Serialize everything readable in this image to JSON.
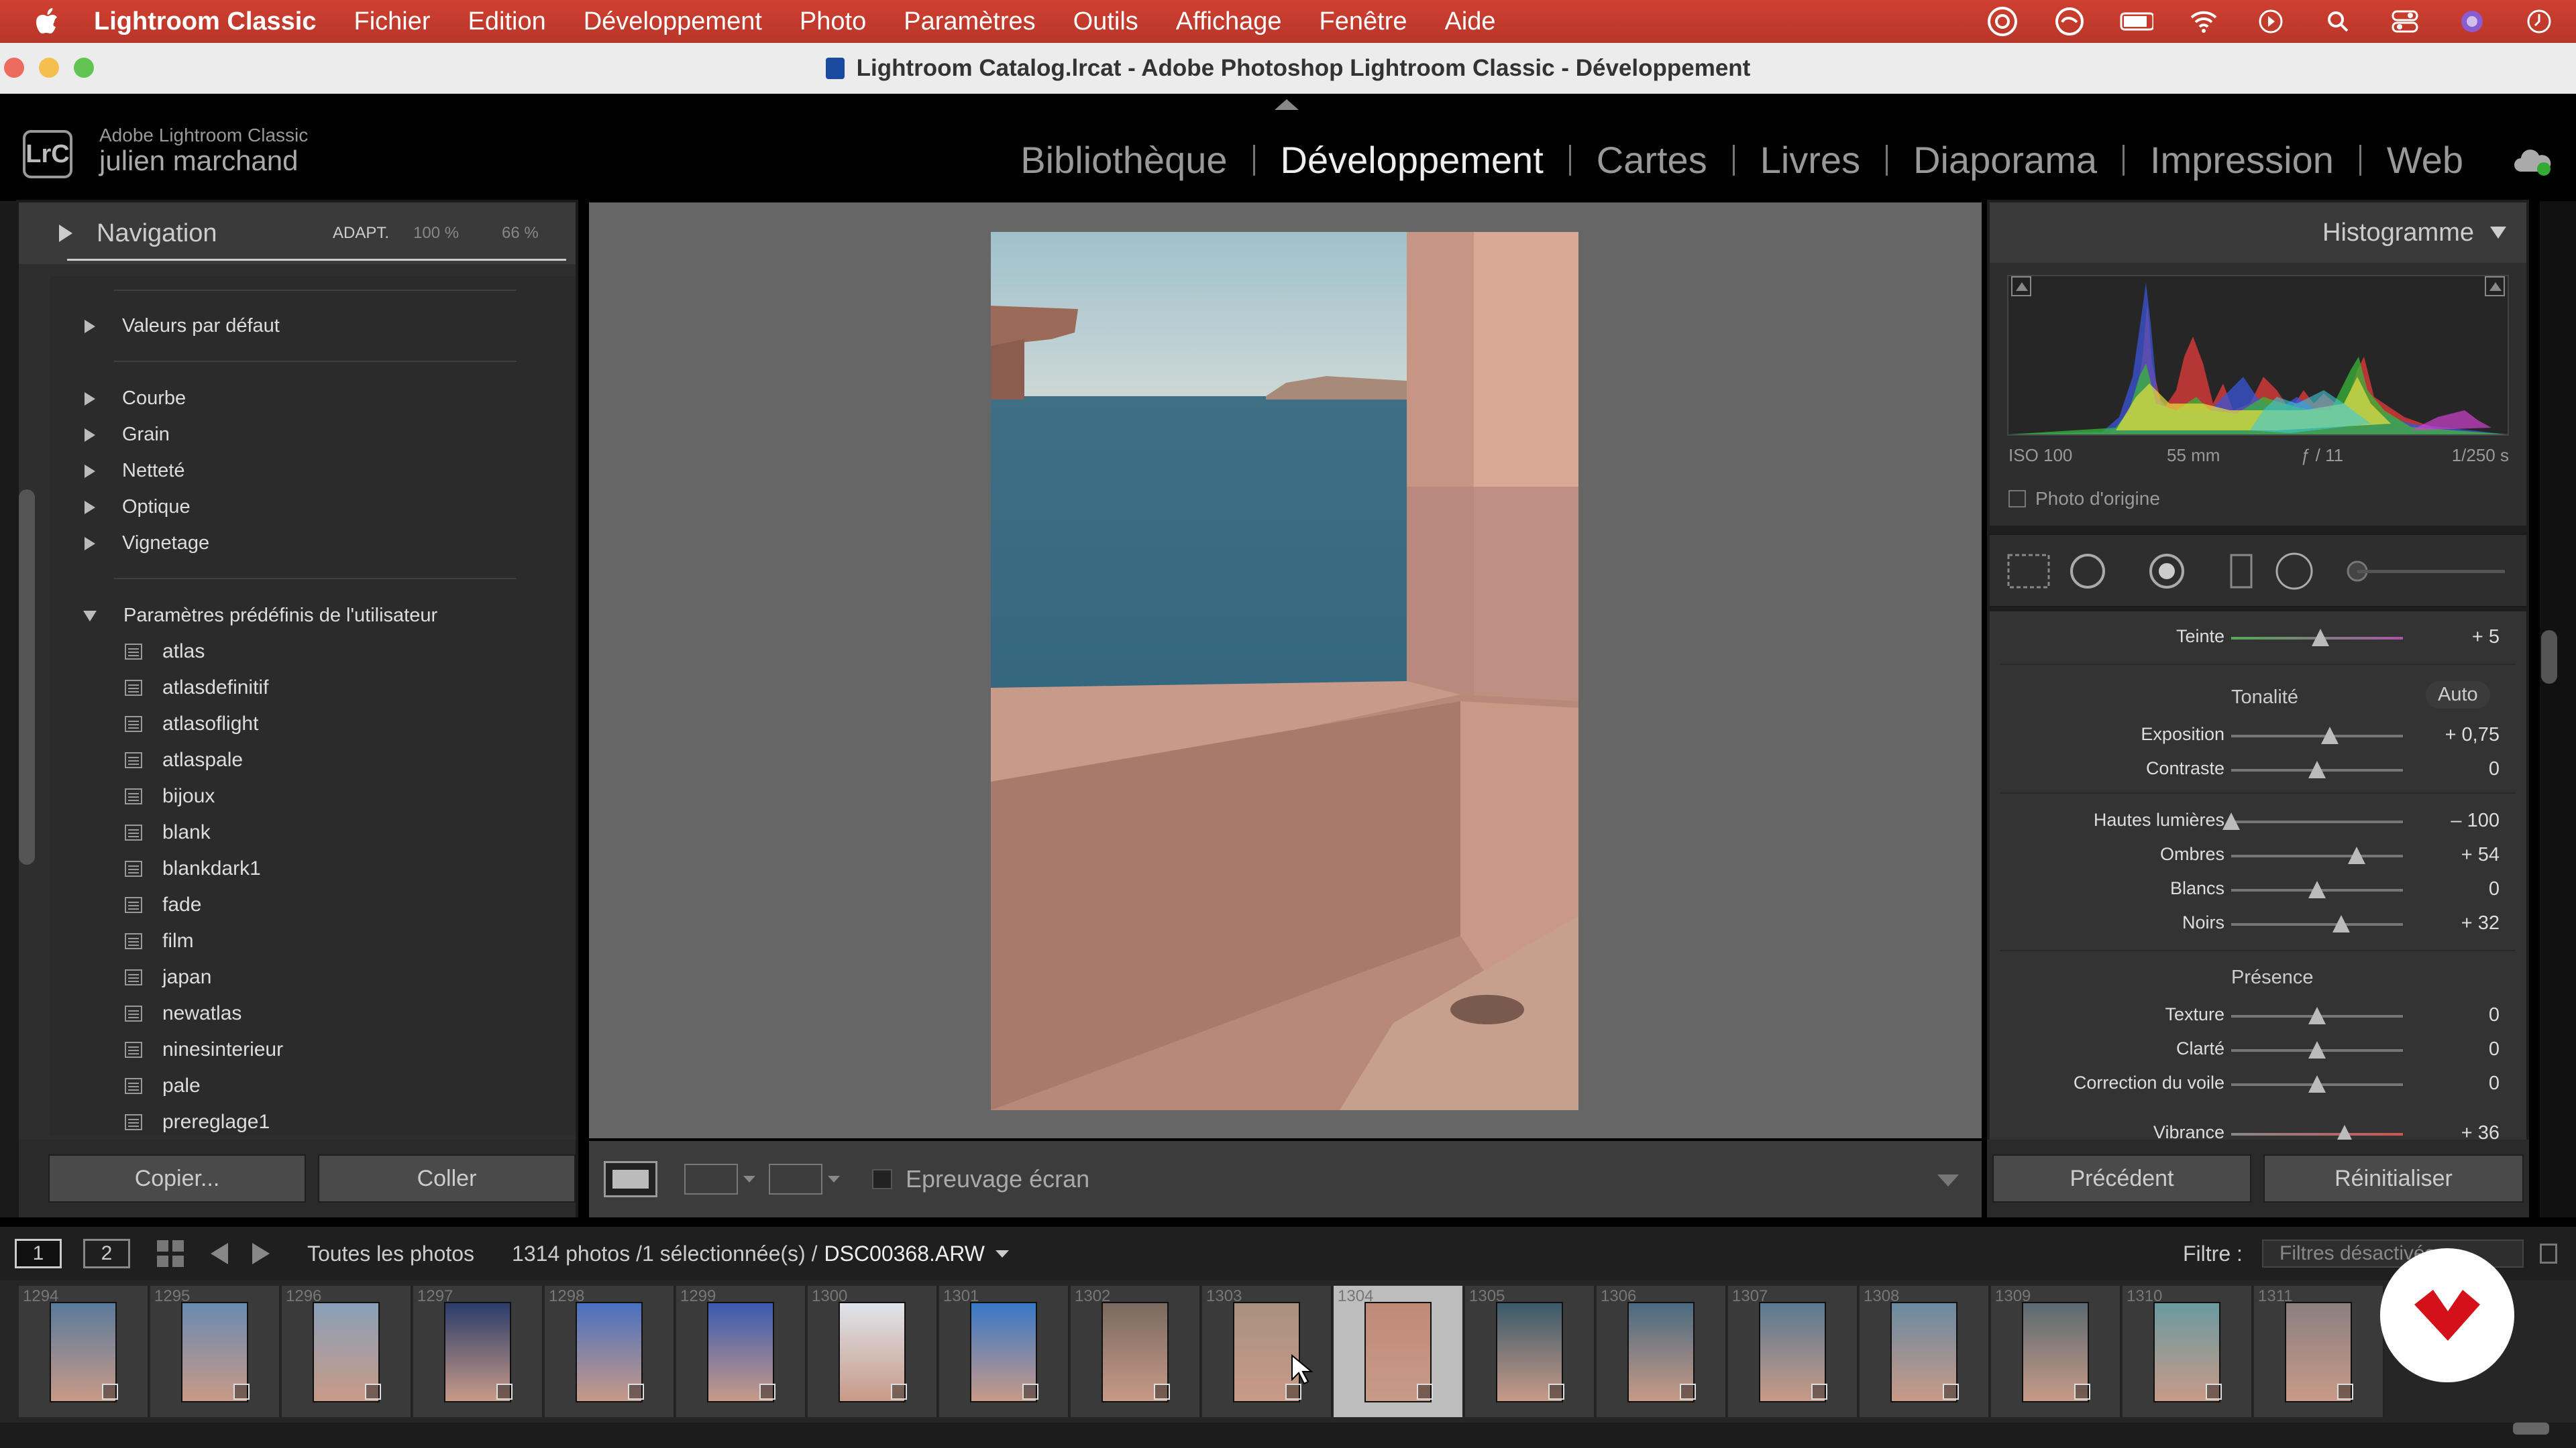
{
  "menubar": {
    "app": "Lightroom Classic",
    "items": [
      "Fichier",
      "Edition",
      "Développement",
      "Photo",
      "Paramètres",
      "Outils",
      "Affichage",
      "Fenêtre",
      "Aide"
    ]
  },
  "window": {
    "title": "Lightroom Catalog.lrcat - Adobe Photoshop Lightroom Classic - Développement"
  },
  "identity": {
    "logo": "LrC",
    "product": "Adobe Lightroom Classic",
    "user": "julien marchand"
  },
  "modules": [
    "Bibliothèque",
    "Développement",
    "Cartes",
    "Livres",
    "Diaporama",
    "Impression",
    "Web"
  ],
  "navigator": {
    "title": "Navigation",
    "fit": "ADAPT.",
    "zoom1": "100 %",
    "zoom2": "66 %"
  },
  "presets": {
    "groups": [
      "Valeurs par défaut",
      "Courbe",
      "Grain",
      "Netteté",
      "Optique",
      "Vignetage"
    ],
    "user_group": "Paramètres prédéfinis de l'utilisateur",
    "user_items": [
      "atlas",
      "atlasdefinitif",
      "atlasoflight",
      "atlaspale",
      "bijoux",
      "blank",
      "blankdark1",
      "fade",
      "film",
      "japan",
      "newatlas",
      "ninesinterieur",
      "pale",
      "prereglage1"
    ]
  },
  "left_buttons": {
    "copy": "Copier...",
    "paste": "Coller"
  },
  "toolbar": {
    "proof": "Epreuvage écran"
  },
  "histogram": {
    "title": "Histogramme",
    "iso": "ISO 100",
    "focal": "55 mm",
    "aperture": "ƒ / 11",
    "shutter": "1/250 s",
    "original": "Photo d'origine"
  },
  "basic": {
    "tint": {
      "label": "Teinte",
      "value": "+ 5",
      "level": 0.52
    },
    "tone_title": "Tonalité",
    "auto": "Auto",
    "tone": [
      {
        "label": "Exposition",
        "value": "+ 0,75",
        "level": 0.575
      },
      {
        "label": "Contraste",
        "value": "0",
        "level": 0.5
      }
    ],
    "tone2": [
      {
        "label": "Hautes lumières",
        "value": "– 100",
        "level": 0.0
      },
      {
        "label": "Ombres",
        "value": "+ 54",
        "level": 0.73
      },
      {
        "label": "Blancs",
        "value": "0",
        "level": 0.5
      },
      {
        "label": "Noirs",
        "value": "+ 32",
        "level": 0.64
      }
    ],
    "presence_title": "Présence",
    "presence": [
      {
        "label": "Texture",
        "value": "0",
        "level": 0.5
      },
      {
        "label": "Clarté",
        "value": "0",
        "level": 0.5
      },
      {
        "label": "Correction du voile",
        "value": "0",
        "level": 0.5
      }
    ],
    "vibrance": {
      "label": "Vibrance",
      "value": "+ 36",
      "level": 0.66
    }
  },
  "right_buttons": {
    "previous": "Précédent",
    "reset": "Réinitialiser"
  },
  "filmstrip_bar": {
    "screen1": "1",
    "screen2": "2",
    "source": "Toutes les photos",
    "count": "1314 photos /1 sélectionnée(s) /",
    "file": "DSC00368.ARW",
    "filter_label": "Filtre :",
    "filter_value": "Filtres désactivés"
  },
  "filmstrip": {
    "numbers": [
      "1294",
      "1295",
      "1296",
      "1297",
      "1298",
      "1299",
      "1300",
      "1301",
      "1302",
      "1303",
      "1304",
      "1305",
      "1306",
      "1307",
      "1308",
      "1309",
      "1310",
      "1311"
    ],
    "selected_index": 10
  }
}
